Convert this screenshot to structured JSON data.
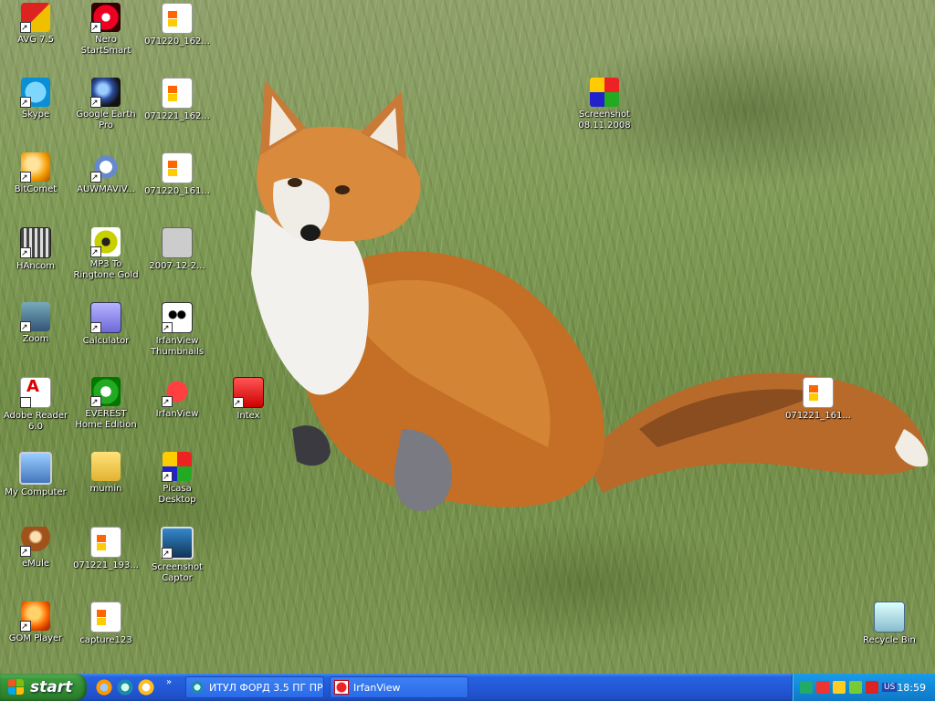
{
  "desktop": {
    "icons": [
      {
        "label": "AVG 7.5"
      },
      {
        "label": "Nero StartSmart"
      },
      {
        "label": "071220_162..."
      },
      {
        "label": "Skype"
      },
      {
        "label": "Google Earth Pro"
      },
      {
        "label": "071221_162..."
      },
      {
        "label": "BitComet"
      },
      {
        "label": "AUWMAVIV..."
      },
      {
        "label": "071220_161..."
      },
      {
        "label": "HAncom"
      },
      {
        "label": "MP3 To Ringtone Gold"
      },
      {
        "label": "2007-12-2..."
      },
      {
        "label": "Zoom"
      },
      {
        "label": "Calculator"
      },
      {
        "label": "IrfanView Thumbnails"
      },
      {
        "label": "Adobe Reader 6.0"
      },
      {
        "label": "EVEREST Home Edition"
      },
      {
        "label": "IrfanView"
      },
      {
        "label": "Intex"
      },
      {
        "label": "My Computer"
      },
      {
        "label": "mumin"
      },
      {
        "label": "Picasa Desktop"
      },
      {
        "label": "eMule"
      },
      {
        "label": "071221_193..."
      },
      {
        "label": "Screenshot Captor"
      },
      {
        "label": "GOM Player"
      },
      {
        "label": "capture123"
      },
      {
        "label": "Screenshot 08.11.2008"
      },
      {
        "label": "071221_161..."
      },
      {
        "label": "Recycle Bin"
      }
    ]
  },
  "taskbar": {
    "start_label": "start",
    "tasks": [
      {
        "label": "ИТУЛ ФОРД 3.5 ПГ ПР..."
      },
      {
        "label": "IrfanView"
      }
    ],
    "language": "US",
    "clock": "18:59"
  }
}
